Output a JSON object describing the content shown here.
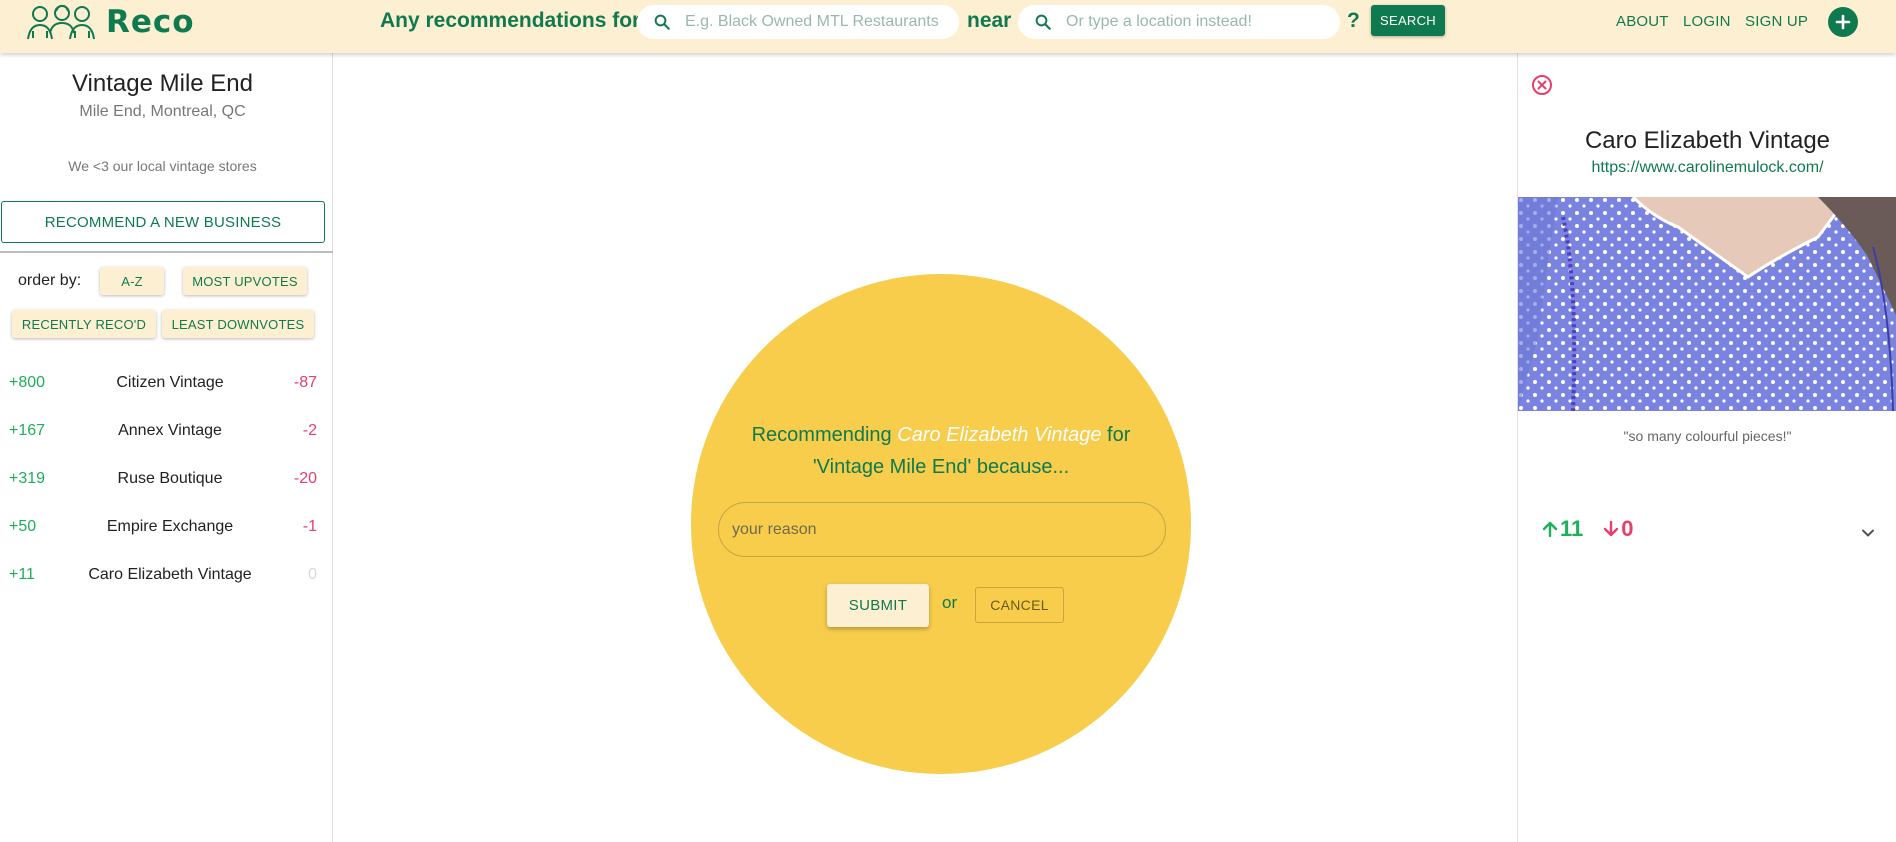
{
  "header": {
    "logo_text": "Reco",
    "query_prefix": "Any recommendations for",
    "query_placeholder": "E.g. Black Owned MTL Restaurants",
    "near_label": "near",
    "location_placeholder": "Or type a location instead!",
    "question_mark": "?",
    "search_label": "SEARCH",
    "nav": {
      "about": "ABOUT",
      "login": "LOGIN",
      "signup": "SIGN UP"
    }
  },
  "list": {
    "title": "Vintage Mile End",
    "location": "Mile End, Montreal, QC",
    "description": "We <3 our local vintage stores",
    "recommend_label": "RECOMMEND A NEW BUSINESS",
    "order_label": "order by:",
    "sort": {
      "az": "A-Z",
      "most_upvotes": "MOST UPVOTES",
      "recent": "RECENTLY RECO'D",
      "least_downvotes": "LEAST DOWNVOTES"
    },
    "businesses": [
      {
        "upvotes": "+800",
        "name": "Citizen Vintage",
        "downvotes": "-87"
      },
      {
        "upvotes": "+167",
        "name": "Annex Vintage",
        "downvotes": "-2"
      },
      {
        "upvotes": "+319",
        "name": "Ruse Boutique",
        "downvotes": "-20"
      },
      {
        "upvotes": "+50",
        "name": "Empire Exchange",
        "downvotes": "-1"
      },
      {
        "upvotes": "+11",
        "name": "Caro Elizabeth Vintage",
        "downvotes": "0"
      }
    ]
  },
  "recommend_modal": {
    "prefix": "Recommending",
    "business": "Caro Elizabeth Vintage",
    "middle": "for",
    "list_ref": "'Vintage Mile End' because...",
    "reason_placeholder": "your reason",
    "submit_label": "SUBMIT",
    "or_label": "or",
    "cancel_label": "CANCEL"
  },
  "detail": {
    "title": "Caro Elizabeth Vintage",
    "url": "https://www.carolinemulock.com/",
    "quote": "\"so many colourful pieces!\"",
    "upvotes": "11",
    "downvotes": "0"
  },
  "colors": {
    "brand_green": "#0f7a4f",
    "header_bg": "#fdf0d2",
    "circle_yellow": "#f7cd4b",
    "upvote_green": "#1db05a",
    "downvote_pink": "#e83e6b"
  }
}
